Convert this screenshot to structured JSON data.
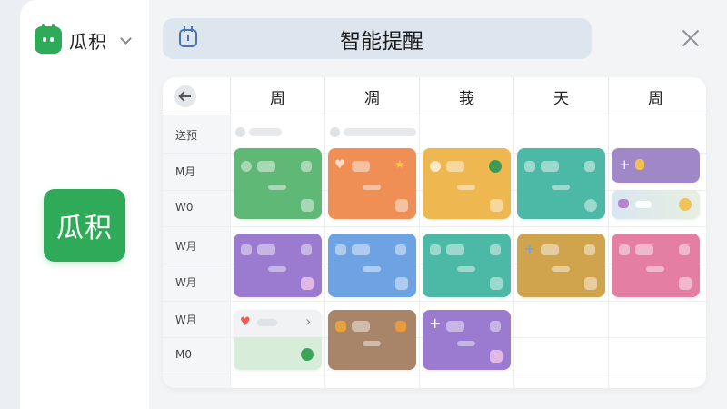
{
  "app": {
    "name": "瓜积",
    "logo_text": "瓜积"
  },
  "search": {
    "value": "智能提醒",
    "placeholder": "智能提醒"
  },
  "calendar": {
    "days": [
      "周",
      "凋",
      "莪",
      "天",
      "周"
    ],
    "time_labels": [
      "送预",
      "M月",
      "W0",
      "W月",
      "W月",
      "W月",
      "M0"
    ]
  },
  "colors": {
    "green": "#5fb876",
    "orange": "#ef8f55",
    "yellow": "#efb74f",
    "teal": "#4cb8a6",
    "lavender": "#9f87c8",
    "purple": "#9a7bcf",
    "blue": "#6ea3e3",
    "mustard": "#d0a44d",
    "pink": "#e47ea3",
    "brown": "#a88569",
    "brand": "#2faa58"
  },
  "icons": {
    "star": "★",
    "plus": "+",
    "heart": "♥",
    "arrow": "›"
  }
}
